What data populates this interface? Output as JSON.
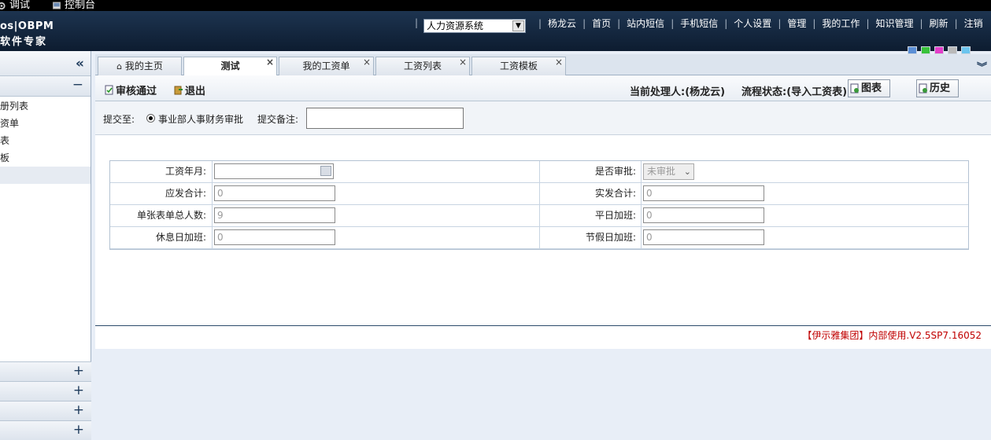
{
  "menubar": {
    "debug_label": "调试",
    "console_label": "控制台"
  },
  "header": {
    "logo_line1": "os|OBPM",
    "logo_line2": "软件专家",
    "system_select": "人力资源系统",
    "nav_links": [
      "杨龙云",
      "首页",
      "站内短信",
      "手机短信",
      "个人设置",
      "管理",
      "我的工作",
      "知识管理",
      "刷新",
      "注销"
    ],
    "skin_colors": [
      "#5b8fd6",
      "#38c23a",
      "#e33ec9",
      "#b9b9b9",
      "#6cc5ee"
    ]
  },
  "sidebar": {
    "collapse_icon": "«",
    "group_toggle": "−",
    "items": [
      "册列表",
      "资单",
      "表",
      "板",
      ""
    ],
    "bottom_toggles": [
      "+",
      "+",
      "+",
      "+"
    ]
  },
  "tabs": [
    {
      "label": "我的主页",
      "closable": false
    },
    {
      "label": "测试",
      "closable": true
    },
    {
      "label": "我的工资单",
      "closable": true
    },
    {
      "label": "工资列表",
      "closable": true
    },
    {
      "label": "工资模板",
      "closable": true
    }
  ],
  "toolbar": {
    "approve_label": "审核通过",
    "exit_label": "退出",
    "handler_text": "当前处理人:(杨龙云)",
    "status_text": "流程状态:(导入工资表)",
    "chart_label": "图表",
    "history_label": "历史"
  },
  "submit": {
    "submit_to_label": "提交至:",
    "option_label": "事业部人事财务审批",
    "remark_label": "提交备注:",
    "remark_value": ""
  },
  "form": {
    "rows": [
      {
        "left_label": "工资年月:",
        "left_value": "",
        "right_label": "是否审批:",
        "right_value": "未审批"
      },
      {
        "left_label": "应发合计:",
        "left_value": "0",
        "right_label": "实发合计:",
        "right_value": "0"
      },
      {
        "left_label": "单张表单总人数:",
        "left_value": "9",
        "right_label": "平日加班:",
        "right_value": "0"
      },
      {
        "left_label": "休息日加班:",
        "left_value": "0",
        "right_label": "节假日加班:",
        "right_value": "0"
      }
    ]
  },
  "footer": {
    "version_text": "【伊示雅集团】内部使用.V2.5SP7.16052"
  }
}
